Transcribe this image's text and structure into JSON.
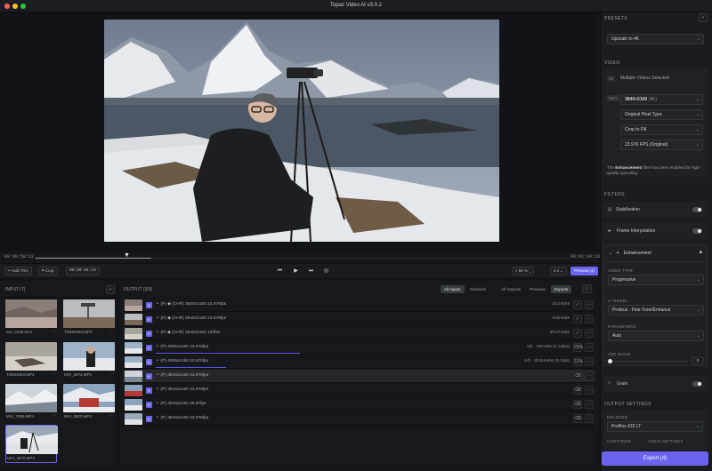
{
  "app": {
    "title": "Topaz Video AI  v3.0.2"
  },
  "colors": {
    "accent": "#6b63f0",
    "bg": "#15161a",
    "panel": "#1b1c21"
  },
  "timeline": {
    "current": "00:00:58:12",
    "end": "00:01:30:23"
  },
  "controls": {
    "edit_trim": "Edit Trim",
    "crop": "Crop",
    "timecode": "00:00:56:19",
    "zoom": "55 %",
    "speed": "2 x",
    "preview": "Preview (4)"
  },
  "input": {
    "header": "INPUT (7)",
    "add": "+",
    "items": [
      {
        "name": "DJI_0106.mov"
      },
      {
        "name": "TD654093.MP4"
      },
      {
        "name": "TD654093.MP4"
      },
      {
        "name": "MVI_3674.MP4"
      },
      {
        "name": "MVI_7856.MP4"
      },
      {
        "name": "MVI_3820.MP4"
      },
      {
        "name": "MVI_3870.MP4"
      }
    ]
  },
  "output": {
    "header": "OUTPUT (3/9)",
    "tabs": [
      "All Inputs",
      "Selected",
      "All Outputs",
      "Previews",
      "Exports"
    ],
    "export_icon": "↑",
    "rows": [
      {
        "badge": "E",
        "text": "(P)  ◆ (CHR)   3840x2160   23.976fps",
        "right": "1h1m55s",
        "btn": "✓"
      },
      {
        "badge": "E",
        "text": "(P)  ◆ (CHR)   3840x2160   23.976fps",
        "right": "2h0m56s",
        "btn": "✓"
      },
      {
        "badge": "E",
        "text": "(P)  ◆ (CHR)   3840x2160   120fps",
        "right": "2h17m55s",
        "btn": "✓"
      },
      {
        "badge": "E",
        "text": "(P)   4096x2160   23.976fps",
        "right": "1/2  ·  39m48s (0.12fps)",
        "btn": "25%",
        "progress": 0.45
      },
      {
        "badge": "E",
        "text": "(P)   4096x2160   23.976fps",
        "right": "1/2  ·  3h11m45s (0.1fps)",
        "btn": "11%",
        "progress": 0.22
      },
      {
        "badge": "E",
        "text": "(P)   3840x2160   23.976fps",
        "right": "",
        "btn": "⌫"
      },
      {
        "badge": "E",
        "text": "(P)   3840x2160   23.976fps",
        "right": "",
        "btn": "⌫"
      },
      {
        "badge": "E",
        "text": "(P)   3840x2160   29.97fps",
        "right": "",
        "btn": "⌫"
      },
      {
        "badge": "E",
        "text": "(P)   3840x2160   23.976fps",
        "right": "",
        "btn": "⌫"
      }
    ]
  },
  "right": {
    "presets_label": "PRESETS",
    "preset": "Upscale to 4K",
    "video_label": "VIDEO",
    "in_label": "IN",
    "multiple": "Multiple Videos Selected",
    "out_label": "OUT",
    "out_resolution": "3840×2160",
    "out_resolution_suffix": "(4K)",
    "pixel_type": "Original Pixel Type",
    "crop": "Crop to Fill",
    "fps": "23.976 FPS (Original)",
    "note_pre": "The ",
    "note_bold": "Enhancement",
    "note_post": " filter has been enabled for high-quality upscaling.",
    "filters_label": "FILTERS",
    "stabilization": "Stabilization",
    "frame_interp": "Frame Interpolation",
    "enhancement": "Enhancement",
    "video_type_label": "VIDEO TYPE",
    "video_type": "Progressive",
    "ai_model_label": "AI MODEL",
    "ai_model": "Proteus - Fine-Tune/Enhance",
    "parameters_label": "PARAMETERS",
    "parameters": "Auto",
    "add_noise_label": "ADD NOISE",
    "add_noise_value": "0",
    "add_noise_level": 0,
    "grain": "Grain",
    "output_settings_label": "OUTPUT SETTINGS",
    "encoder_label": "ENCODER",
    "encoder": "ProRes 422 LT",
    "container_label": "CONTAINER",
    "audio_label": "AUDIO SETTINGS",
    "export": "Export (4)"
  }
}
